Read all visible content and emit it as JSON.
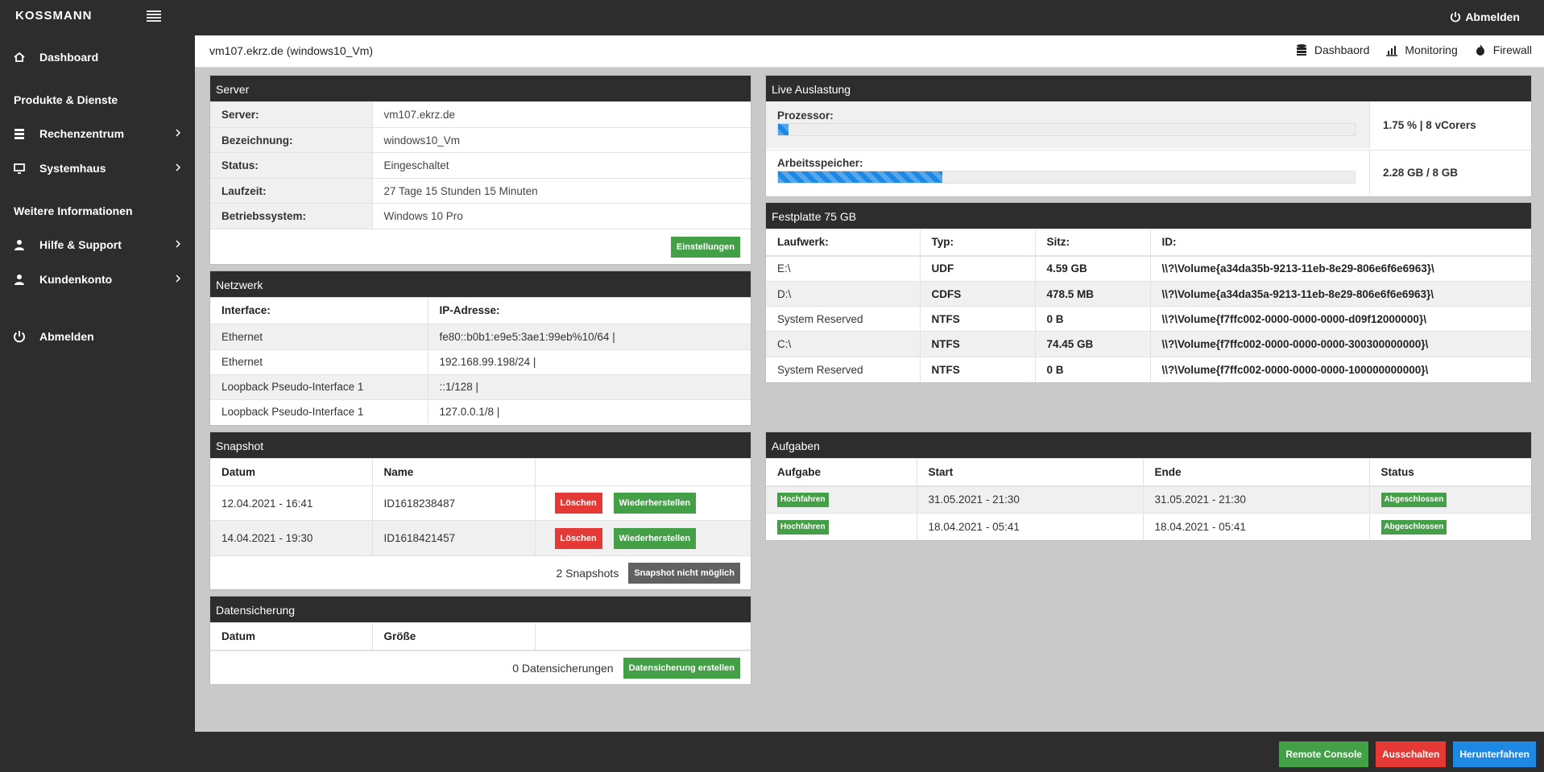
{
  "brand": "KOSSMANN",
  "top": {
    "logout": "Abmelden"
  },
  "sidebar": {
    "dashboard": "Dashboard",
    "section1": "Produkte & Dienste",
    "rechenzentrum": "Rechenzentrum",
    "systemhaus": "Systemhaus",
    "section2": "Weitere Informationen",
    "hilfe": "Hilfe & Support",
    "kundenkonto": "Kundenkonto",
    "abmelden": "Abmelden"
  },
  "subbar": {
    "title": "vm107.ekrz.de (windows10_Vm)",
    "links": [
      "Dashbaord",
      "Monitoring",
      "Firewall"
    ]
  },
  "server": {
    "title": "Server",
    "rows": [
      [
        "Server:",
        "vm107.ekrz.de"
      ],
      [
        "Bezeichnung:",
        "windows10_Vm"
      ],
      [
        "Status:",
        "Eingeschaltet"
      ],
      [
        "Laufzeit:",
        "27 Tage 15 Stunden 15 Minuten"
      ],
      [
        "Betriebssystem:",
        "Windows 10 Pro"
      ]
    ],
    "button": "Einstellungen"
  },
  "network": {
    "title": "Netzwerk",
    "headers": [
      "Interface:",
      "IP-Adresse:"
    ],
    "rows": [
      [
        "Ethernet",
        "fe80::b0b1:e9e5:3ae1:99eb%10/64 |"
      ],
      [
        "Ethernet",
        "192.168.99.198/24 |"
      ],
      [
        "Loopback Pseudo-Interface 1",
        "::1/128 |"
      ],
      [
        "Loopback Pseudo-Interface 1",
        "127.0.0.1/8 |"
      ]
    ]
  },
  "snapshot": {
    "title": "Snapshot",
    "headers": [
      "Datum",
      "Name"
    ],
    "rows": [
      [
        "12.04.2021 - 16:41",
        "ID1618238487"
      ],
      [
        "14.04.2021 - 19:30",
        "ID1618421457"
      ]
    ],
    "delete_label": "Löschen",
    "restore_label": "Wiederherstellen",
    "count": "2 Snapshots",
    "action": "Snapshot nicht möglich"
  },
  "backup": {
    "title": "Datensicherung",
    "headers": [
      "Datum",
      "Größe"
    ],
    "count": "0 Datensicherungen",
    "action": "Datensicherung erstellen"
  },
  "live": {
    "title": "Live Auslastung",
    "cpu_label": "Prozessor:",
    "cpu_value": "1.75 % | 8 vCorers",
    "cpu_percent": 1.75,
    "ram_label": "Arbeitsspeicher:",
    "ram_value": "2.28 GB / 8 GB",
    "ram_percent": 28.5
  },
  "disk": {
    "title": "Festplatte 75 GB",
    "headers": [
      "Laufwerk:",
      "Typ:",
      "Sitz:",
      "ID:"
    ],
    "rows": [
      [
        "E:\\",
        "UDF",
        "4.59 GB",
        "\\\\?\\Volume{a34da35b-9213-11eb-8e29-806e6f6e6963}\\"
      ],
      [
        "D:\\",
        "CDFS",
        "478.5 MB",
        "\\\\?\\Volume{a34da35a-9213-11eb-8e29-806e6f6e6963}\\"
      ],
      [
        "System Reserved",
        "NTFS",
        "0 B",
        "\\\\?\\Volume{f7ffc002-0000-0000-0000-d09f12000000}\\"
      ],
      [
        "C:\\",
        "NTFS",
        "74.45 GB",
        "\\\\?\\Volume{f7ffc002-0000-0000-0000-300300000000}\\"
      ],
      [
        "System Reserved",
        "NTFS",
        "0 B",
        "\\\\?\\Volume{f7ffc002-0000-0000-0000-100000000000}\\"
      ]
    ]
  },
  "tasks": {
    "title": "Aufgaben",
    "headers": [
      "Aufgabe",
      "Start",
      "Ende",
      "Status"
    ],
    "rows": [
      [
        "Hochfahren",
        "31.05.2021 - 21:30",
        "31.05.2021 - 21:30",
        "Abgeschlossen"
      ],
      [
        "Hochfahren",
        "18.04.2021 - 05:41",
        "18.04.2021 - 05:41",
        "Abgeschlossen"
      ]
    ]
  },
  "bottom": {
    "console": "Remote Console",
    "off": "Ausschalten",
    "shutdown": "Herunterfahren"
  },
  "colors": {
    "green": "#43a047",
    "red": "#e53935",
    "blue": "#1e88e5",
    "dark": "#2d2d2d"
  }
}
